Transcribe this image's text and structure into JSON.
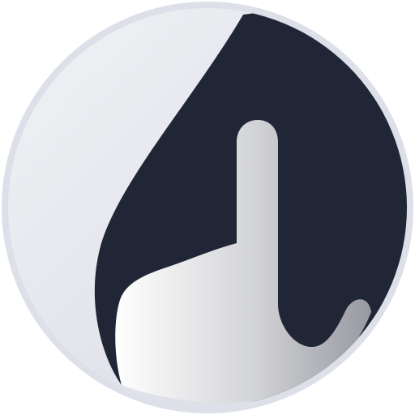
{
  "icon": {
    "name": "pointing-hand-icon",
    "colors": {
      "background": "#ffffff",
      "disc_light": "#f1f2f5",
      "disc_dark": "#d7dae3",
      "rim": "#dde0e9",
      "shape_dark": "#212637",
      "hand_light": "#ffffff",
      "hand_mid": "#d2d3d6",
      "hand_dark": "#9799a1"
    }
  }
}
